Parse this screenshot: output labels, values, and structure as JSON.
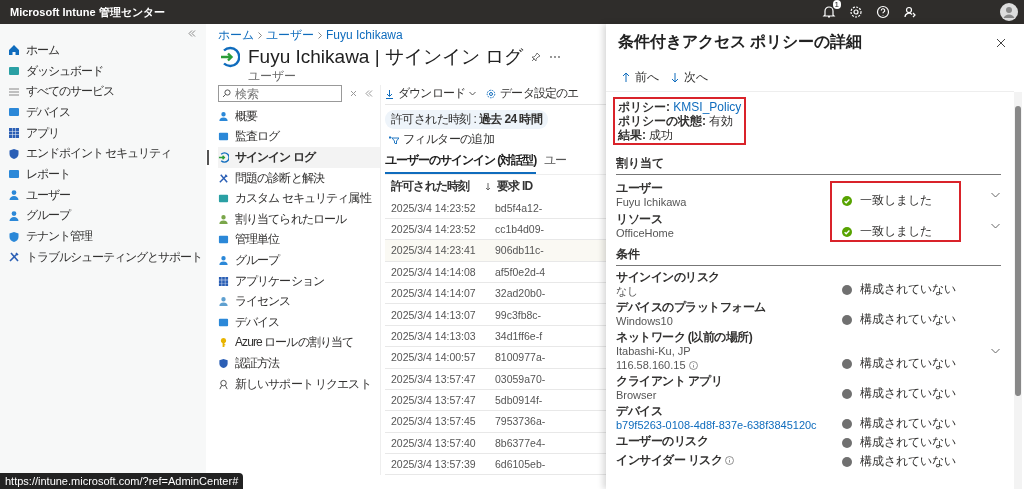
{
  "header": {
    "title": "Microsoft Intune 管理センター",
    "notification_count": "1"
  },
  "nav": {
    "items": [
      {
        "label": "ホーム",
        "selected": false
      },
      {
        "label": "ダッシュボード",
        "selected": false
      },
      {
        "label": "すべてのサービス",
        "selected": false
      },
      {
        "label": "デバイス",
        "selected": false
      },
      {
        "label": "アプリ",
        "selected": false
      },
      {
        "label": "エンドポイント セキュリティ",
        "selected": false
      },
      {
        "label": "レポート",
        "selected": false
      },
      {
        "label": "ユーザー",
        "selected": false
      },
      {
        "label": "グループ",
        "selected": false
      },
      {
        "label": "テナント管理",
        "selected": false
      },
      {
        "label": "トラブルシューティングとサポート",
        "selected": false
      }
    ]
  },
  "blade": {
    "breadcrumb": [
      "ホーム",
      "ユーザー",
      "Fuyu Ichikawa"
    ],
    "title": "Fuyu Ichikawa | サインイン ログ",
    "subtitle": "ユーザー",
    "search": {
      "placeholder": "検索"
    },
    "menu": [
      {
        "label": "概要",
        "selected": false
      },
      {
        "label": "監査ログ",
        "selected": false
      },
      {
        "label": "サインイン ログ",
        "selected": true
      },
      {
        "label": "問題の診断と解決",
        "selected": false
      },
      {
        "label": "カスタム セキュリティ属性",
        "selected": false
      },
      {
        "label": "割り当てられたロール",
        "selected": false
      },
      {
        "label": "管理単位",
        "selected": false
      },
      {
        "label": "グループ",
        "selected": false
      },
      {
        "label": "アプリケーション",
        "selected": false
      },
      {
        "label": "ライセンス",
        "selected": false
      },
      {
        "label": "デバイス",
        "selected": false
      },
      {
        "label": "Azure ロールの割り当て",
        "selected": false
      },
      {
        "label": "認証方法",
        "selected": false
      },
      {
        "label": "新しいサポート リクエスト",
        "selected": false
      }
    ]
  },
  "log": {
    "toolbar": [
      {
        "label": "ダウンロード",
        "dropdown": true
      },
      {
        "label": "データ設定のエ",
        "dropdown": false
      }
    ],
    "time_filter": "許可された時刻 : **過去 24 時間**",
    "add_filter": "フィルターの追加",
    "tabs": [
      {
        "label": "ユーザーのサインイン (対話型)",
        "selected": true
      },
      {
        "label": "ユー",
        "selected": false
      }
    ],
    "columns": [
      "許可された時刻",
      "要求 ID"
    ],
    "rows": [
      {
        "time": "2025/3/4 14:23:52",
        "id": "bd5f4a12-",
        "selected": false
      },
      {
        "time": "2025/3/4 14:23:52",
        "id": "cc1b4d09-",
        "selected": false
      },
      {
        "time": "2025/3/4 14:23:41",
        "id": "906db11c-",
        "selected": true
      },
      {
        "time": "2025/3/4 14:14:08",
        "id": "af5f0e2d-4",
        "selected": false
      },
      {
        "time": "2025/3/4 14:14:07",
        "id": "32ad20b0-",
        "selected": false
      },
      {
        "time": "2025/3/4 14:13:07",
        "id": "99c3fb8c-",
        "selected": false
      },
      {
        "time": "2025/3/4 14:13:03",
        "id": "34d1ff6e-f",
        "selected": false
      },
      {
        "time": "2025/3/4 14:00:57",
        "id": "8100977a-",
        "selected": false
      },
      {
        "time": "2025/3/4 13:57:47",
        "id": "03059a70-",
        "selected": false
      },
      {
        "time": "2025/3/4 13:57:47",
        "id": "5db0914f-",
        "selected": false
      },
      {
        "time": "2025/3/4 13:57:45",
        "id": "7953736a-",
        "selected": false
      },
      {
        "time": "2025/3/4 13:57:40",
        "id": "8b6377e4-",
        "selected": false
      },
      {
        "time": "2025/3/4 13:57:39",
        "id": "6d6105eb-",
        "selected": false
      }
    ]
  },
  "panel": {
    "title": "条件付きアクセス ポリシーの詳細",
    "nav": [
      "前へ",
      "次へ"
    ],
    "summary": {
      "highlighted": true,
      "lines": [
        {
          "label": "ポリシー:",
          "value": "KMSI_Policy",
          "kind": "link"
        },
        {
          "label": "ポリシーの状態:",
          "value": "有効",
          "kind": "text"
        },
        {
          "label": "結果:",
          "value": "成功",
          "kind": "text"
        }
      ]
    },
    "assignments": {
      "heading": "割り当て",
      "highlighted": true,
      "items": [
        {
          "label": "ユーザー",
          "values": [
            {
              "text": "Fuyu Ichikawa",
              "kind": "text",
              "info": false
            }
          ],
          "kind": "matched",
          "status_text": "一致しました",
          "expandable": true
        },
        {
          "label": "リソース",
          "values": [
            {
              "text": "OfficeHome",
              "kind": "text",
              "info": false
            }
          ],
          "kind": "matched",
          "status_text": "一致しました",
          "expandable": true
        }
      ]
    },
    "conditions": {
      "heading": "条件",
      "items": [
        {
          "label": "サインインのリスク",
          "label_info": false,
          "values": [
            {
              "text": "なし",
              "kind": "text",
              "info": false
            }
          ],
          "kind": "not_configured",
          "status_text": "構成されていない",
          "expandable": false
        },
        {
          "label": "デバイスのプラットフォーム",
          "label_info": false,
          "values": [
            {
              "text": "Windows10",
              "kind": "text",
              "info": false
            }
          ],
          "kind": "not_configured",
          "status_text": "構成されていない",
          "expandable": false
        },
        {
          "label": "ネットワーク (以前の場所)",
          "label_info": false,
          "values": [
            {
              "text": "Itabashi-Ku, JP",
              "kind": "text",
              "info": false
            },
            {
              "text": "116.58.160.15",
              "kind": "text",
              "info": true
            }
          ],
          "kind": "not_configured",
          "status_text": "構成されていない",
          "expandable": true
        },
        {
          "label": "クライアント アプリ",
          "label_info": false,
          "values": [
            {
              "text": "Browser",
              "kind": "text",
              "info": false
            }
          ],
          "kind": "not_configured",
          "status_text": "構成されていない",
          "expandable": false
        },
        {
          "label": "デバイス",
          "label_info": false,
          "values": [
            {
              "text": "b79f5263-0108-4d8f-837e-638f3845120c",
              "kind": "link",
              "info": false
            }
          ],
          "kind": "not_configured",
          "status_text": "構成されていない",
          "expandable": false
        },
        {
          "label": "ユーザーのリスク",
          "label_info": false,
          "kind": "not_configured",
          "status_text": "構成されていない",
          "expandable": false
        },
        {
          "label": "インサイダー リスク",
          "label_info": true,
          "kind": "not_configured",
          "status_text": "構成されていない",
          "expandable": false
        }
      ]
    }
  },
  "status_url": "https://intune.microsoft.com/?ref=AdminCenter#"
}
